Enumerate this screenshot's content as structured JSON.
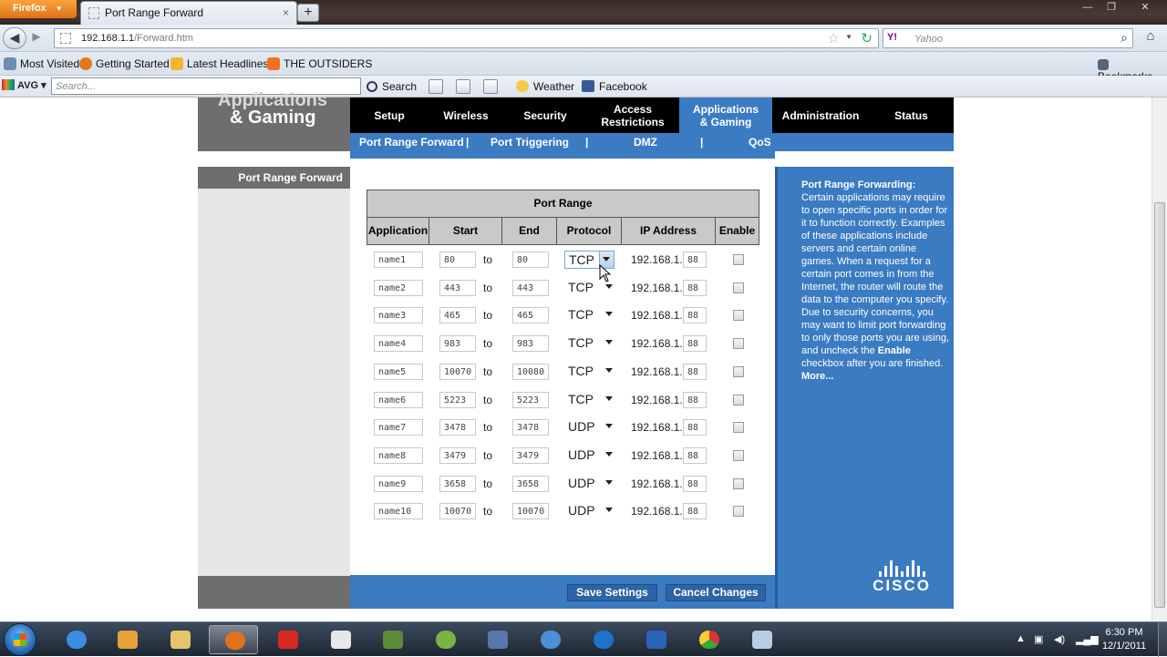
{
  "browser": {
    "app_menu": "Firefox",
    "tab_title": "Port Range Forward",
    "url_host": "192.168.1.1",
    "url_path": "/Forward.htm",
    "search_engine": "Y!",
    "search_placeholder": "Yahoo",
    "bookmarks": [
      "Most Visited",
      "Getting Started",
      "Latest Headlines",
      "THE OUTSIDERS"
    ],
    "bookmarks_menu": "Bookmarks",
    "avg": {
      "brand": "AVG",
      "search_placeholder": "Search...",
      "search_button": "Search",
      "weather": "Weather",
      "facebook": "Facebook"
    }
  },
  "router": {
    "section_title_line1": "Applications",
    "section_title_line2": "& Gaming",
    "nav": [
      "Setup",
      "Wireless",
      "Security",
      "Access\nRestrictions",
      "Applications\n& Gaming",
      "Administration",
      "Status"
    ],
    "active_nav": "Applications & Gaming",
    "subnav": [
      "Port Range Forward",
      "|",
      "Port Triggering",
      "|",
      "DMZ",
      "|",
      "QoS"
    ],
    "left_label": "Port Range Forward",
    "table": {
      "caption": "Port Range",
      "headers": [
        "Application",
        "Start",
        "End",
        "Protocol",
        "IP Address",
        "Enable"
      ],
      "to_label": "to",
      "ip_prefix": "192.168.1.",
      "rows": [
        {
          "app": "name1",
          "start": "80",
          "end": "80",
          "protocol": "TCP",
          "ip": "88",
          "enabled": false
        },
        {
          "app": "name2",
          "start": "443",
          "end": "443",
          "protocol": "TCP",
          "ip": "88",
          "enabled": false
        },
        {
          "app": "name3",
          "start": "465",
          "end": "465",
          "protocol": "TCP",
          "ip": "88",
          "enabled": false
        },
        {
          "app": "name4",
          "start": "983",
          "end": "983",
          "protocol": "TCP",
          "ip": "88",
          "enabled": false
        },
        {
          "app": "name5",
          "start": "10070",
          "end": "10080",
          "protocol": "TCP",
          "ip": "88",
          "enabled": false
        },
        {
          "app": "name6",
          "start": "5223",
          "end": "5223",
          "protocol": "TCP",
          "ip": "88",
          "enabled": false
        },
        {
          "app": "name7",
          "start": "3478",
          "end": "3478",
          "protocol": "UDP",
          "ip": "88",
          "enabled": false
        },
        {
          "app": "name8",
          "start": "3479",
          "end": "3479",
          "protocol": "UDP",
          "ip": "88",
          "enabled": false
        },
        {
          "app": "name9",
          "start": "3658",
          "end": "3658",
          "protocol": "UDP",
          "ip": "88",
          "enabled": false
        },
        {
          "app": "name10",
          "start": "10070",
          "end": "10070",
          "protocol": "UDP",
          "ip": "88",
          "enabled": false
        }
      ]
    },
    "help": {
      "title": "Port Range Forwarding:",
      "text_before_bold": "Certain applications may require to open specific ports in order for it to function correctly. Examples of these applications include servers and certain online games. When a request for a certain port comes in from the Internet, the router will route the data to the computer you specify. Due to security concerns, you may want to limit port forwarding to only those ports you are using, and uncheck the ",
      "bold_word": "Enable",
      "text_after_bold": " checkbox after you are finished.",
      "more": "More..."
    },
    "brand": "CISCO",
    "buttons": {
      "save": "Save Settings",
      "cancel": "Cancel Changes"
    }
  },
  "taskbar": {
    "time": "6:30 PM",
    "date": "12/1/2011"
  },
  "colors": {
    "router_blue": "#3b7bc2",
    "router_gray": "#6e6e6e",
    "header_black": "#000000",
    "firefox_orange": "#e2711b"
  }
}
